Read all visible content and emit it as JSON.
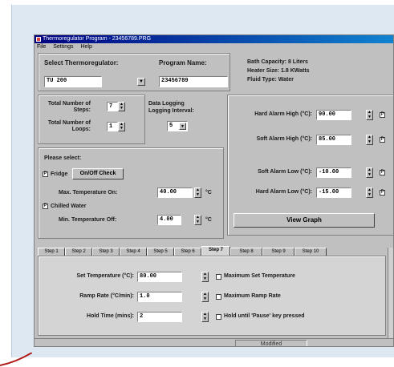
{
  "window": {
    "title": "Thermoregulator Program - 23456789.PRG",
    "menu": [
      "File",
      "Settings",
      "Help"
    ]
  },
  "header": {
    "select_label": "Select Thermoregulator:",
    "select_value": "TU 200",
    "program_label": "Program Name:",
    "program_value": "23456789",
    "bath_capacity": "Bath Capacity: 8 Liters",
    "heater_size": "Heater Size: 1.8 KWatts",
    "fluid_type": "Fluid Type: Water"
  },
  "steps": {
    "total_steps_label": "Total Number of Steps:",
    "total_steps_value": "7",
    "total_loops_label": "Total Number of Loops:",
    "total_loops_value": "1",
    "data_logging_label": "Data Logging",
    "logging_interval_label": "Logging Interval:",
    "logging_interval_value": "5"
  },
  "alarms": {
    "hard_high_label": "Hard Alarm High (°C):",
    "hard_high_value": "90.00",
    "soft_high_label": "Soft Alarm High (°C):",
    "soft_high_value": "85.00",
    "soft_low_label": "Soft Alarm Low (°C):",
    "soft_low_value": "-10.00",
    "hard_low_label": "Hard Alarm Low (°C):",
    "hard_low_value": "-15.00",
    "check_mark": "P"
  },
  "select": {
    "title": "Please select:",
    "fridge_label": "Fridge",
    "onoff_button": "On/Off Check",
    "max_temp_label": "Max. Temperature On:",
    "max_temp_value": "40.00",
    "chilled_label": "Chilled Water",
    "min_temp_label": "Min. Temperature Off:",
    "min_temp_value": "4.00",
    "unit": "°C",
    "check_mark": "P"
  },
  "view_graph": "View Graph",
  "tabs": [
    "Step 1",
    "Step 2",
    "Step 3",
    "Step 4",
    "Step 5",
    "Step 6",
    "Step 7",
    "Step 8",
    "Step 9",
    "Step 10"
  ],
  "step_panel": {
    "set_temp_label": "Set Temperature (°C):",
    "set_temp_value": "80.00",
    "ramp_rate_label": "Ramp Rate (°C/min):",
    "ramp_rate_value": "1.0",
    "hold_time_label": "Hold Time (mins):",
    "hold_time_value": "2",
    "max_set_temp": "Maximum Set Temperature",
    "max_ramp_rate": "Maximum Ramp Rate",
    "hold_until": "Hold until 'Pause' key pressed"
  },
  "status": "Modified"
}
